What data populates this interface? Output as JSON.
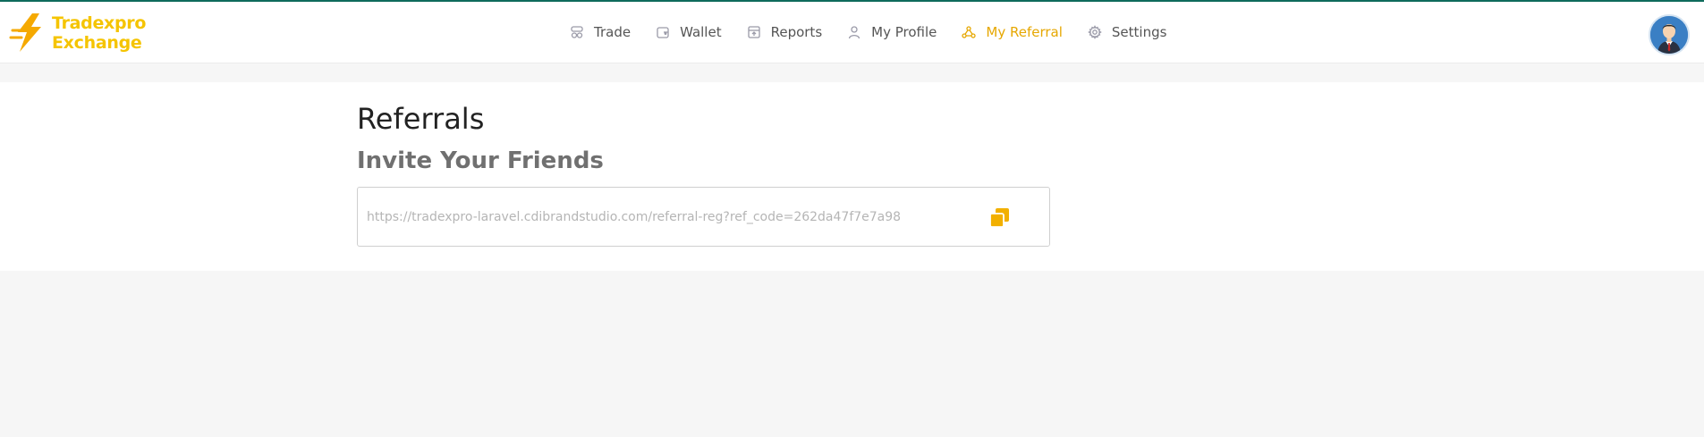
{
  "brand": {
    "line1": "Tradexpro",
    "line2": "Exchange",
    "color": "#f5c400"
  },
  "nav": {
    "items": [
      {
        "label": "Trade",
        "icon": "trade-icon"
      },
      {
        "label": "Wallet",
        "icon": "wallet-icon"
      },
      {
        "label": "Reports",
        "icon": "reports-icon"
      },
      {
        "label": "My Profile",
        "icon": "user-icon"
      },
      {
        "label": "My Referral",
        "icon": "referral-icon",
        "active": true
      },
      {
        "label": "Settings",
        "icon": "gear-icon"
      }
    ],
    "active_color": "#e6a700"
  },
  "user": {
    "avatar_icon": "avatar-icon"
  },
  "page": {
    "title": "Referrals",
    "section_title": "Invite Your Friends",
    "referral_link": "https://tradexpro-laravel.cdibrandstudio.com/referral-reg?ref_code=262da47f7e7a98",
    "copy_icon": "copy-icon"
  }
}
